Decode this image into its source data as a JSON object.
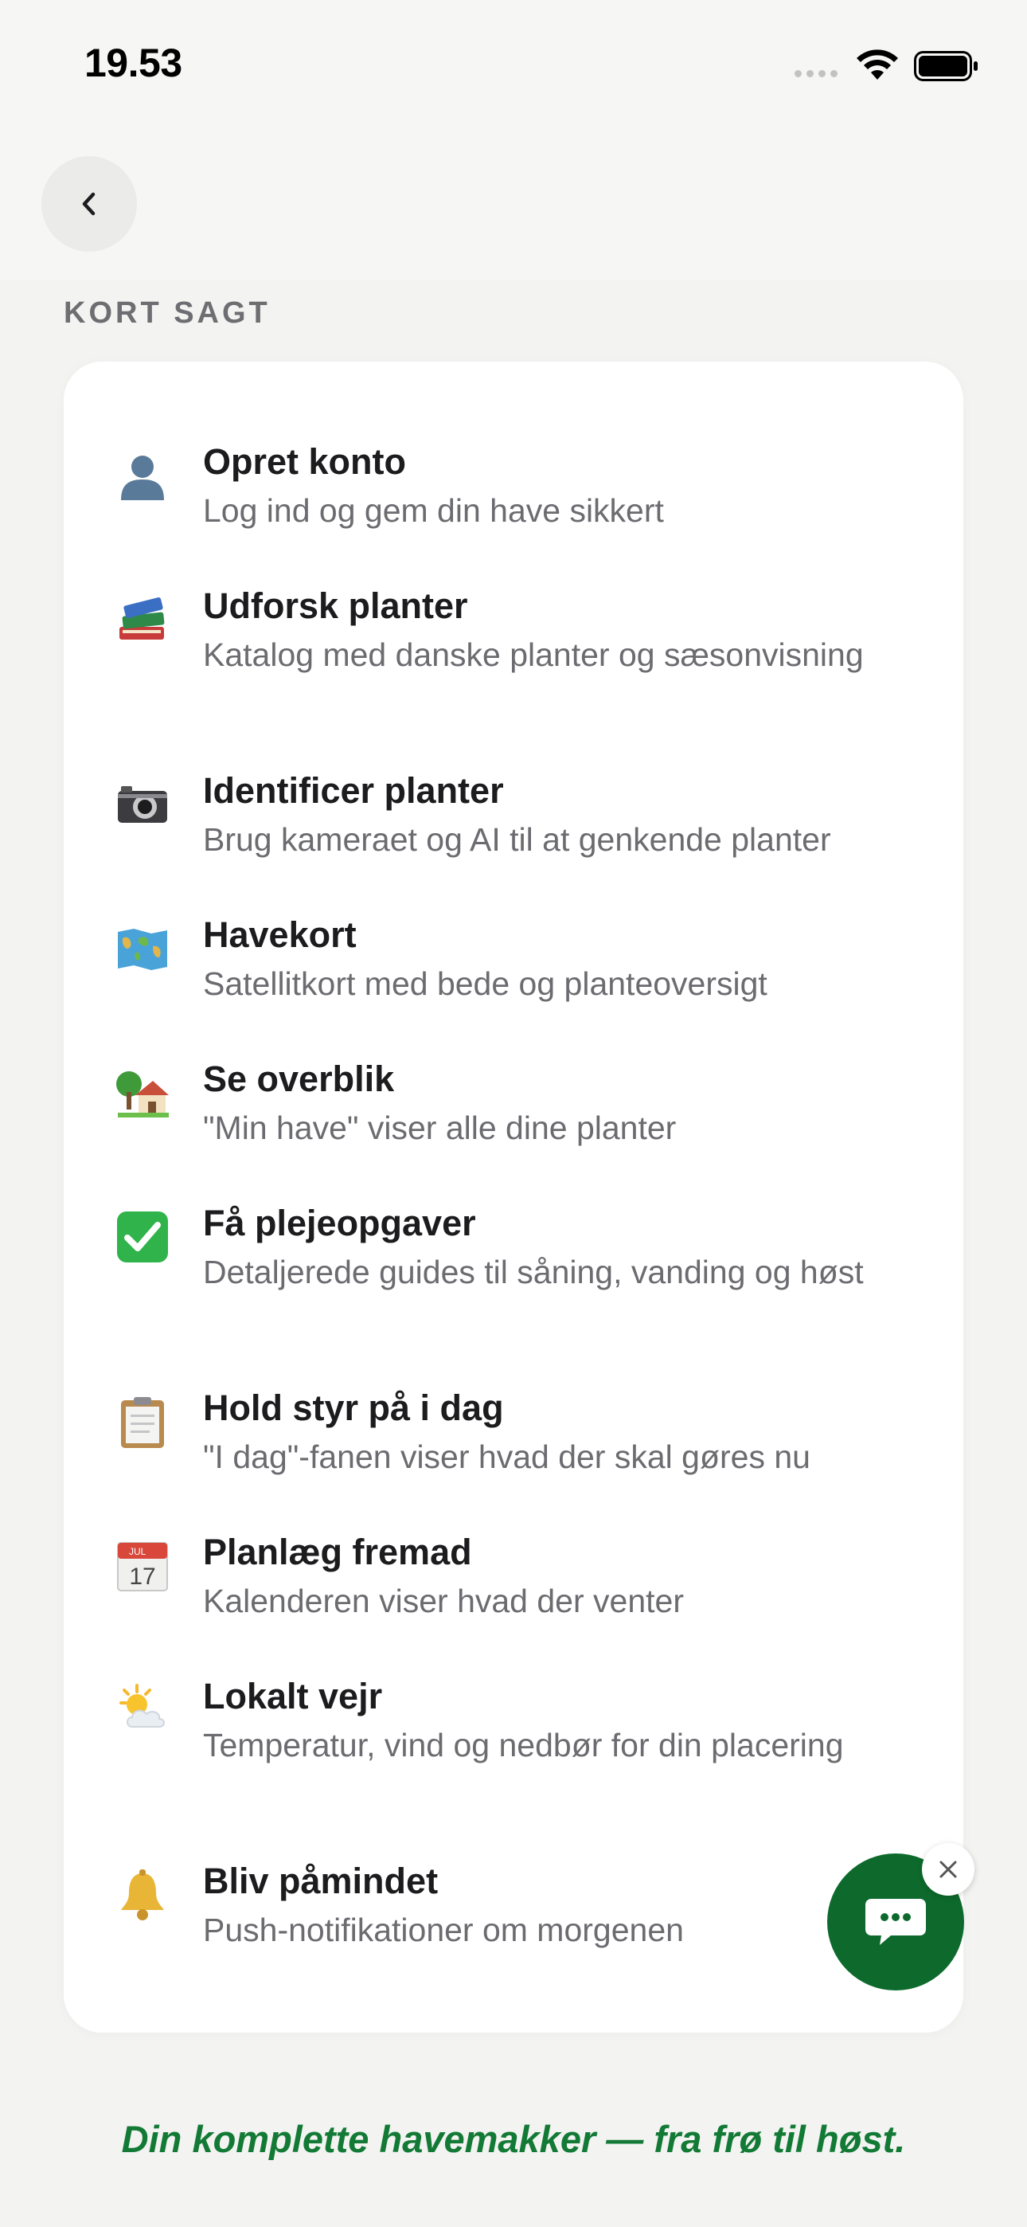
{
  "status_bar": {
    "time": "19.53"
  },
  "nav": {
    "back_icon": "chevron-left-icon"
  },
  "section": {
    "label": "KORT SAGT"
  },
  "features": [
    {
      "icon": "person-silhouette-icon",
      "title": "Opret konto",
      "description": "Log ind og gem din have sikkert"
    },
    {
      "icon": "books-icon",
      "title": "Udforsk planter",
      "description": "Katalog med danske planter og sæsonvisning"
    },
    {
      "icon": "camera-icon",
      "title": "Identificer planter",
      "description": "Brug kameraet og AI til at genkende planter"
    },
    {
      "icon": "world-map-icon",
      "title": "Havekort",
      "description": "Satellitkort med bede og planteoversigt"
    },
    {
      "icon": "house-with-garden-icon",
      "title": "Se overblik",
      "description": "\"Min have\" viser alle dine planter"
    },
    {
      "icon": "check-mark-button-icon",
      "title": "Få plejeopgaver",
      "description": "Detaljerede guides til såning, vanding og høst"
    },
    {
      "icon": "clipboard-icon",
      "title": "Hold styr på i dag",
      "description": "\"I dag\"-fanen viser hvad der skal gøres nu"
    },
    {
      "icon": "calendar-icon",
      "title": "Planlæg fremad",
      "description": "Kalenderen viser hvad der venter",
      "calendar_month": "JUL",
      "calendar_day": "17"
    },
    {
      "icon": "sun-behind-cloud-icon",
      "title": "Lokalt vejr",
      "description": "Temperatur, vind og nedbør for din placering"
    },
    {
      "icon": "bell-icon",
      "title": "Bliv påmindet",
      "description": "Push-notifikationer om morgenen"
    }
  ],
  "chat": {
    "icon": "chat-bubble-icon",
    "close_icon": "close-icon",
    "accent": "#0d6a2c"
  },
  "tagline": "Din komplette havemakker — fra frø til høst.",
  "colors": {
    "accent": "#127a35",
    "background": "#f6f6f5",
    "card": "#ffffff"
  }
}
